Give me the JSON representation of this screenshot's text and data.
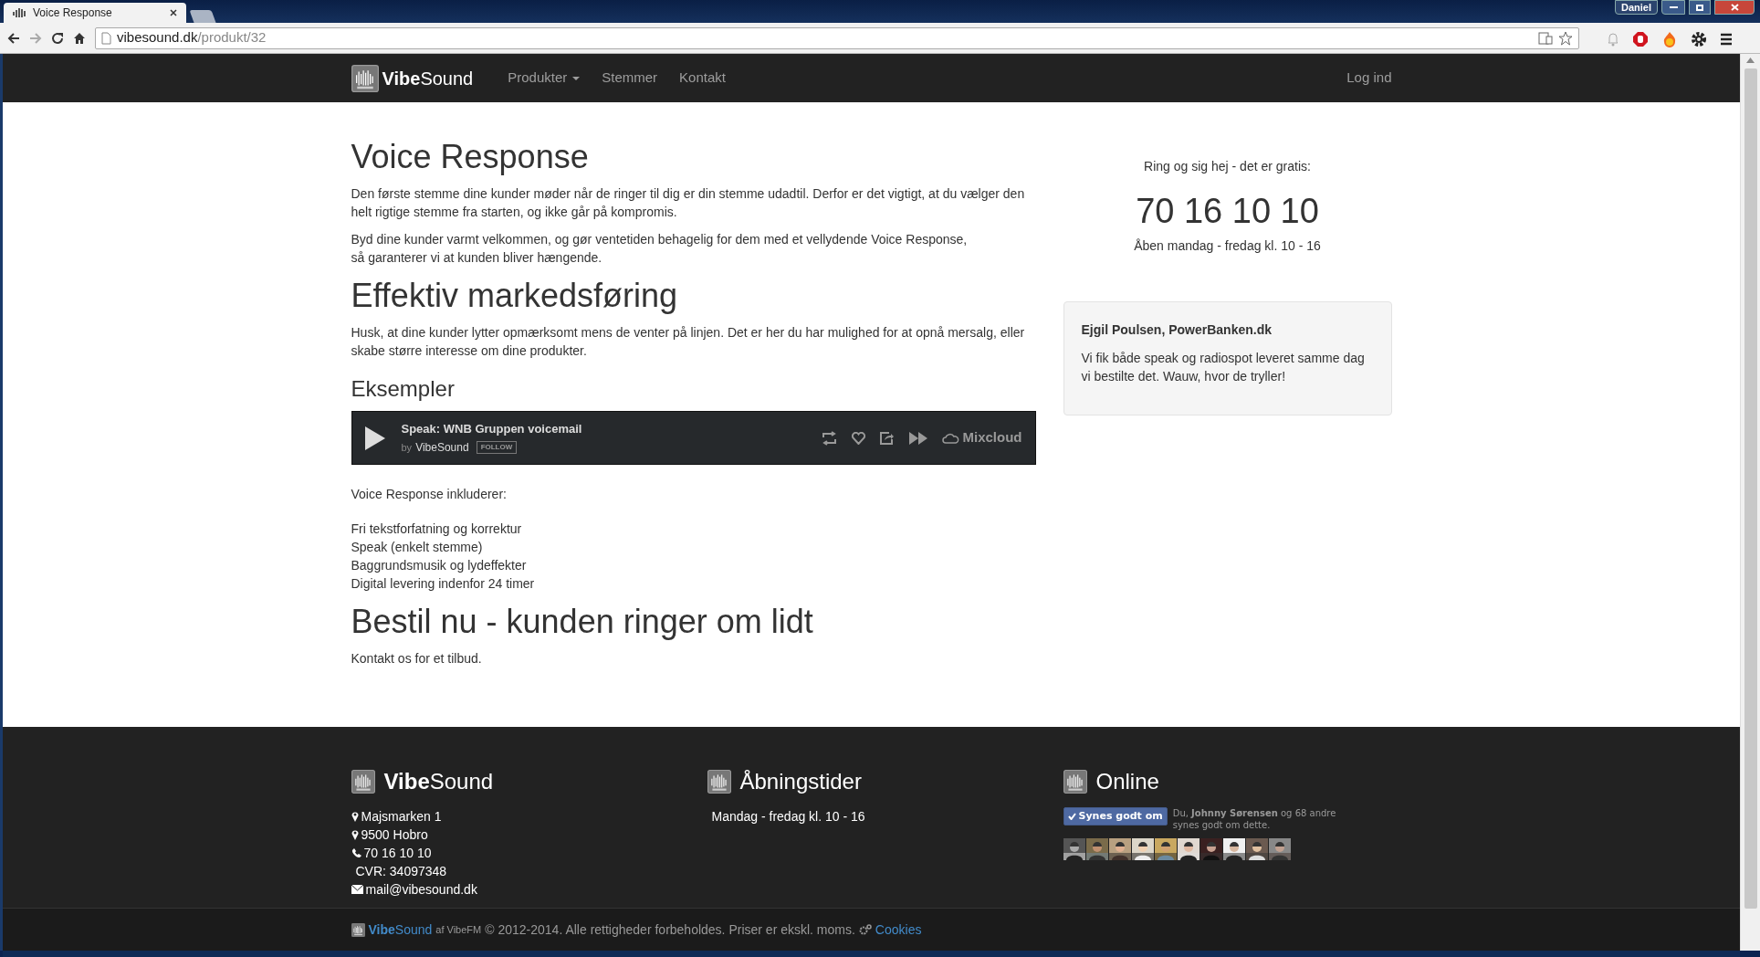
{
  "browser": {
    "tab_title": "Voice Response",
    "url_host": "vibesound.dk",
    "url_path": "/produkt/32",
    "profile": "Daniel"
  },
  "navbar": {
    "brand": "**Vibe**Sound",
    "items": [
      {
        "label": "Produkter",
        "dropdown": true
      },
      {
        "label": "Stemmer",
        "dropdown": false
      },
      {
        "label": "Kontakt",
        "dropdown": false
      }
    ],
    "login": "Log ind"
  },
  "main": [
    {
      "kind": "h1",
      "text": "Voice Response"
    },
    {
      "kind": "p",
      "lines": [
        "Den første stemme dine kunder møder når de ringer til dig er din stemme udadtil. Derfor er det vigtigt, at du vælger den helt rigtige stemme fra starten, og ikke går på kompromis."
      ]
    },
    {
      "kind": "p",
      "lines": [
        "Byd dine kunder varmt velkommen, og gør ventetiden behagelig for dem med et vellydende Voice Response,",
        "så garanterer vi at kunden bliver hængende."
      ]
    },
    {
      "kind": "h1",
      "text": "Effektiv markedsføring"
    },
    {
      "kind": "p",
      "lines": [
        "Husk, at dine kunder lytter opmærksomt mens de venter på linjen. Det er her du har mulighed for at opnå mersalg, eller skabe større interesse om dine produkter."
      ]
    },
    {
      "kind": "h3",
      "text": "Eksempler"
    },
    {
      "kind": "player",
      "title": "Speak: WNB Gruppen voicemail",
      "by": "by",
      "artist": "VibeSound",
      "follow": "FOLLOW",
      "brand": "Mixcloud"
    },
    {
      "kind": "p",
      "lines": [
        "Voice Response inkluderer:"
      ]
    },
    {
      "kind": "list",
      "items": [
        "Fri tekstforfatning og korrektur",
        "Speak (enkelt stemme)",
        "Baggrundsmusik og lydeffekter",
        "Digital levering indenfor 24 timer"
      ]
    },
    {
      "kind": "h1",
      "text": "Bestil nu - kunden ringer om lidt"
    },
    {
      "kind": "p",
      "lines": [
        "Kontakt os for et tilbud."
      ]
    }
  ],
  "sidebar": {
    "intro": "Ring og sig hej - det er gratis:",
    "phone": "70 16 10 10",
    "hours": "Åben mandag - fredag kl. 10 - 16",
    "testimonial": {
      "author": "Ejgil Poulsen, PowerBanken.dk",
      "quote": "Vi fik både speak og radiospot leveret samme dag vi bestilte det. Wauw, hvor de tryller!"
    }
  },
  "footer": {
    "columns": [
      {
        "kind": "contact",
        "title": "**Vibe**Sound",
        "lines": [
          {
            "kind": "pin",
            "text": "Majsmarken 1"
          },
          {
            "kind": "pin",
            "text": "9500 Hobro"
          },
          {
            "kind": "phone",
            "text": "70 16 10 10"
          },
          {
            "kind": "plain",
            "text": "CVR: 34097348"
          },
          {
            "kind": "mail",
            "text": "mail@vibesound.dk"
          }
        ]
      },
      {
        "kind": "hours",
        "title": "Åbningstider",
        "lines": [
          {
            "kind": "plain",
            "text": "Mandag - fredag kl. 10 - 16"
          }
        ]
      },
      {
        "kind": "online",
        "title": "Online",
        "like_button": "Synes godt om",
        "like_text": "Du, **Johnny Sørensen** og 68 andre synes godt om dette."
      }
    ]
  },
  "bottom": {
    "brand": "**Vibe**Sound",
    "by": "af VibeFM",
    "copyright": "© 2012-2014. Alle rettigheder forbeholdes. Priser er ekskl. moms.",
    "cookies": "Cookies"
  }
}
